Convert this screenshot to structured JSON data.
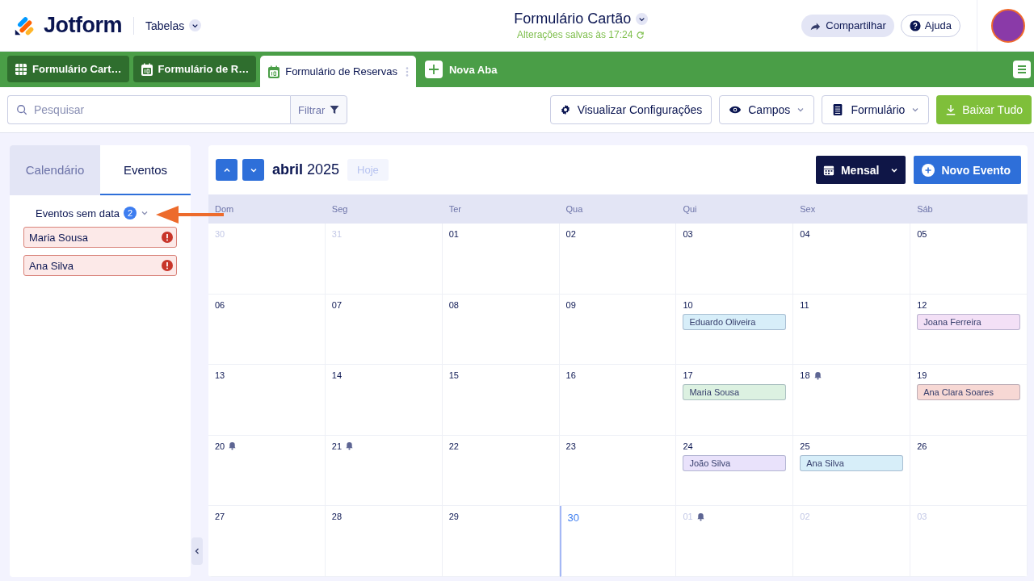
{
  "header": {
    "logo": "Jotform",
    "section": "Tabelas",
    "title": "Formulário Cartão",
    "status": "Alterações salvas às 17:24",
    "share": "Compartilhar",
    "help": "Ajuda"
  },
  "tabs": [
    {
      "label": "Formulário Cart…",
      "kind": "table",
      "selected": false
    },
    {
      "label": "Formulário de R…",
      "kind": "calendar",
      "selected": false
    },
    {
      "label": "Formulário de Reservas",
      "kind": "calendar",
      "selected": true
    }
  ],
  "new_tab": "Nova Aba",
  "toolbar": {
    "search": {
      "placeholder": "Pesquisar"
    },
    "filter": "Filtrar",
    "view_settings": "Visualizar Configurações",
    "fields": "Campos",
    "form": "Formulário",
    "download": "Baixar Tudo"
  },
  "side_panel": {
    "tabs": [
      {
        "label": "Calendário",
        "selected": false
      },
      {
        "label": "Eventos",
        "selected": true
      }
    ],
    "undated": {
      "label": "Eventos sem data",
      "count": "2",
      "items": [
        "Maria Sousa",
        "Ana Silva"
      ]
    }
  },
  "calendar": {
    "month": "abril",
    "year": "2025",
    "today": "Hoje",
    "view": "Mensal",
    "new_event": "Novo Evento",
    "weekdays": [
      "Dom",
      "Seg",
      "Ter",
      "Qua",
      "Qui",
      "Sex",
      "Sáb"
    ],
    "weeks": [
      [
        {
          "day": "30",
          "muted": true,
          "today": false,
          "reminder": false
        },
        {
          "day": "31",
          "muted": true,
          "today": false,
          "reminder": false
        },
        {
          "day": "01",
          "muted": false,
          "today": false,
          "reminder": false
        },
        {
          "day": "02",
          "muted": false,
          "today": false,
          "reminder": false
        },
        {
          "day": "03",
          "muted": false,
          "today": false,
          "reminder": false
        },
        {
          "day": "04",
          "muted": false,
          "today": false,
          "reminder": false
        },
        {
          "day": "05",
          "muted": false,
          "today": false,
          "reminder": false
        }
      ],
      [
        {
          "day": "06",
          "muted": false,
          "today": false,
          "reminder": false
        },
        {
          "day": "07",
          "muted": false,
          "today": false,
          "reminder": false
        },
        {
          "day": "08",
          "muted": false,
          "today": false,
          "reminder": false
        },
        {
          "day": "09",
          "muted": false,
          "today": false,
          "reminder": false
        },
        {
          "day": "10",
          "muted": false,
          "today": false,
          "reminder": false,
          "events": [
            {
              "name": "Eduardo Oliveira",
              "color": "#d7eef9"
            }
          ]
        },
        {
          "day": "11",
          "muted": false,
          "today": false,
          "reminder": false
        },
        {
          "day": "12",
          "muted": false,
          "today": false,
          "reminder": false,
          "events": [
            {
              "name": "Joana Ferreira",
              "color": "#f3e0f6"
            }
          ]
        }
      ],
      [
        {
          "day": "13",
          "muted": false,
          "today": false,
          "reminder": false
        },
        {
          "day": "14",
          "muted": false,
          "today": false,
          "reminder": false
        },
        {
          "day": "15",
          "muted": false,
          "today": false,
          "reminder": false
        },
        {
          "day": "16",
          "muted": false,
          "today": false,
          "reminder": false
        },
        {
          "day": "17",
          "muted": false,
          "today": false,
          "reminder": false,
          "events": [
            {
              "name": "Maria Sousa",
              "color": "#dcf1e1"
            }
          ]
        },
        {
          "day": "18",
          "muted": false,
          "today": false,
          "reminder": true
        },
        {
          "day": "19",
          "muted": false,
          "today": false,
          "reminder": false,
          "events": [
            {
              "name": "Ana Clara Soares",
              "color": "#f7d8d4"
            }
          ]
        }
      ],
      [
        {
          "day": "20",
          "muted": false,
          "today": false,
          "reminder": true
        },
        {
          "day": "21",
          "muted": false,
          "today": false,
          "reminder": true
        },
        {
          "day": "22",
          "muted": false,
          "today": false,
          "reminder": false
        },
        {
          "day": "23",
          "muted": false,
          "today": false,
          "reminder": false
        },
        {
          "day": "24",
          "muted": false,
          "today": false,
          "reminder": false,
          "events": [
            {
              "name": "João Silva",
              "color": "#e9e2fb"
            }
          ]
        },
        {
          "day": "25",
          "muted": false,
          "today": false,
          "reminder": false,
          "events": [
            {
              "name": "Ana Silva",
              "color": "#d7eef9"
            }
          ]
        },
        {
          "day": "26",
          "muted": false,
          "today": false,
          "reminder": false
        }
      ],
      [
        {
          "day": "27",
          "muted": false,
          "today": false,
          "reminder": false
        },
        {
          "day": "28",
          "muted": false,
          "today": false,
          "reminder": false
        },
        {
          "day": "29",
          "muted": false,
          "today": false,
          "reminder": false
        },
        {
          "day": "30",
          "muted": false,
          "today": true,
          "reminder": false
        },
        {
          "day": "01",
          "muted": true,
          "today": false,
          "reminder": true
        },
        {
          "day": "02",
          "muted": true,
          "today": false,
          "reminder": false
        },
        {
          "day": "03",
          "muted": true,
          "today": false,
          "reminder": false
        }
      ]
    ]
  }
}
